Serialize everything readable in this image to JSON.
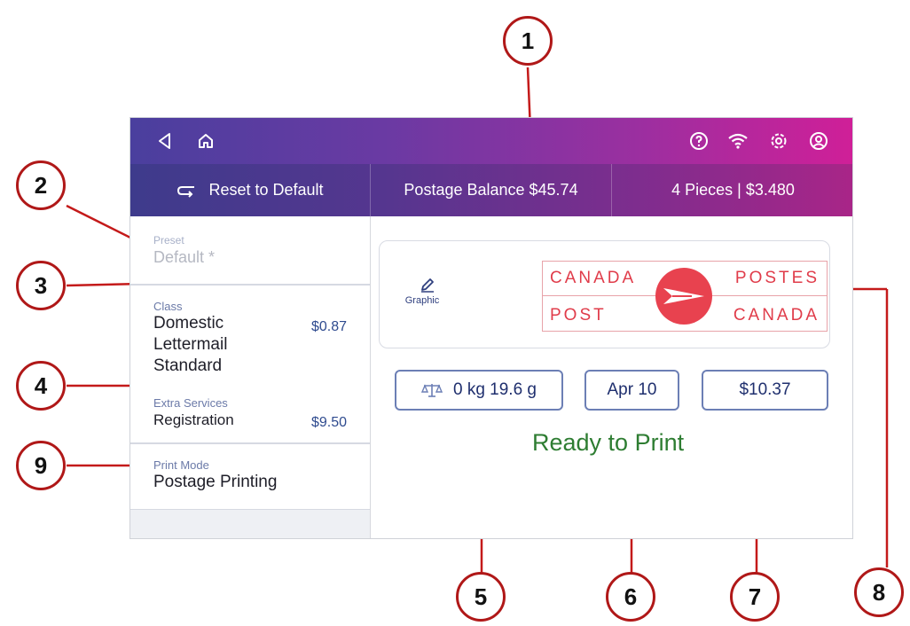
{
  "header": {
    "back_icon": "back-triangle-icon",
    "home_icon": "home-icon",
    "right_icons": [
      "help-icon",
      "wifi-icon",
      "settings-icon",
      "account-icon"
    ]
  },
  "action_bar": {
    "reset_label": "Reset to Default",
    "balance_label": "Postage Balance $45.74",
    "pieces_label": "4 Pieces | $3.480"
  },
  "sidebar": {
    "preset": {
      "label": "Preset",
      "value": "Default *"
    },
    "class": {
      "label": "Class",
      "lines": [
        "Domestic",
        "Lettermail",
        "Standard"
      ],
      "price": "$0.87"
    },
    "extra_services": {
      "label": "Extra Services",
      "value": "Registration",
      "price": "$9.50"
    },
    "print_mode": {
      "label": "Print Mode",
      "value": "Postage Printing"
    }
  },
  "main": {
    "graphic_label": "Graphic",
    "logo": {
      "tl": "CANADA",
      "tr": "POSTES",
      "bl": "POST",
      "br": "CANADA",
      "color": "#e03c4a"
    },
    "weight": "0 kg 19.6 g",
    "date": "Apr 10",
    "amount": "$10.37",
    "status": "Ready to Print",
    "status_color": "#2e7d32"
  },
  "callouts": [
    "1",
    "2",
    "3",
    "4",
    "5",
    "6",
    "7",
    "8",
    "9"
  ]
}
